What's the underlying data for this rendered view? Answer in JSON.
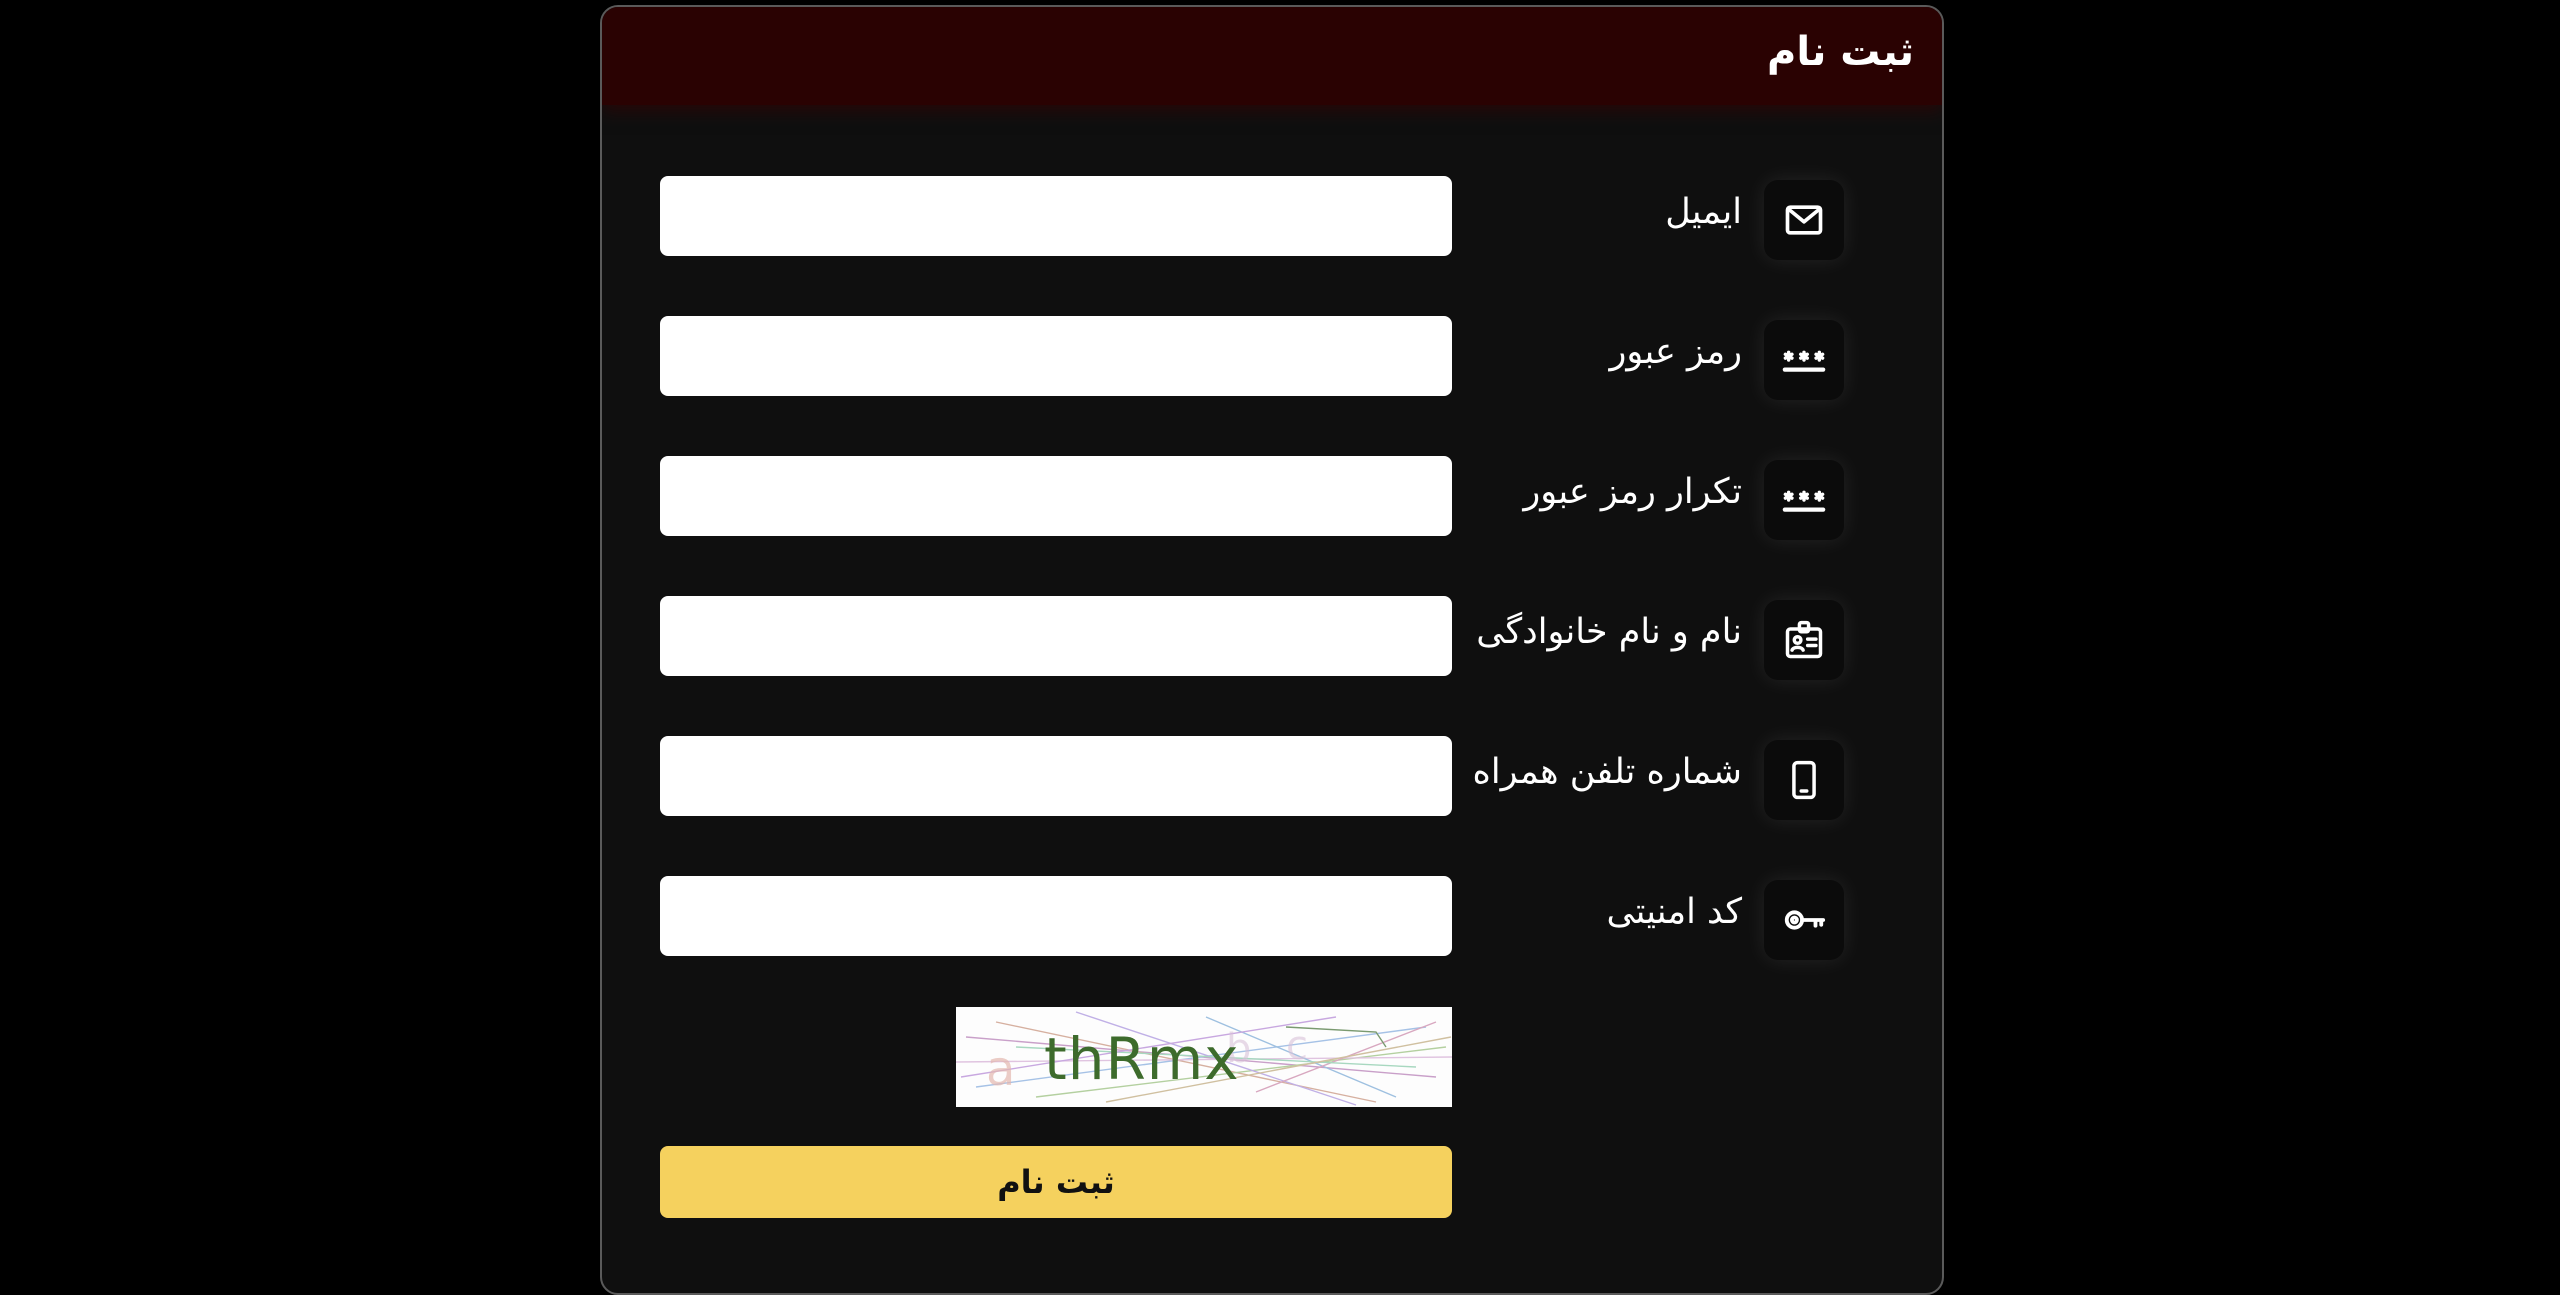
{
  "form": {
    "title": "ثبت نام",
    "fields": [
      {
        "label": "ایمیل",
        "icon": "envelope-icon",
        "value": "",
        "placeholder": ""
      },
      {
        "label": "رمز عبور",
        "icon": "password-dots-icon",
        "value": "",
        "placeholder": ""
      },
      {
        "label": "تکرار رمز عبور",
        "icon": "password-dots-icon",
        "value": "",
        "placeholder": ""
      },
      {
        "label": "نام و نام خانوادگی",
        "icon": "id-badge-icon",
        "value": "",
        "placeholder": ""
      },
      {
        "label": "شماره تلفن همراه",
        "icon": "mobile-phone-icon",
        "value": "",
        "placeholder": ""
      },
      {
        "label": "کد امنیتی",
        "icon": "key-icon",
        "value": "",
        "placeholder": ""
      }
    ],
    "captcha_text": "thRmx",
    "submit_label": "ثبت نام"
  },
  "colors": {
    "background": "#000000",
    "panel": "#0f0f0f",
    "header": "#2a0202",
    "submit": "#f5d15e",
    "input": "#ffffff",
    "text": "#ffffff"
  }
}
